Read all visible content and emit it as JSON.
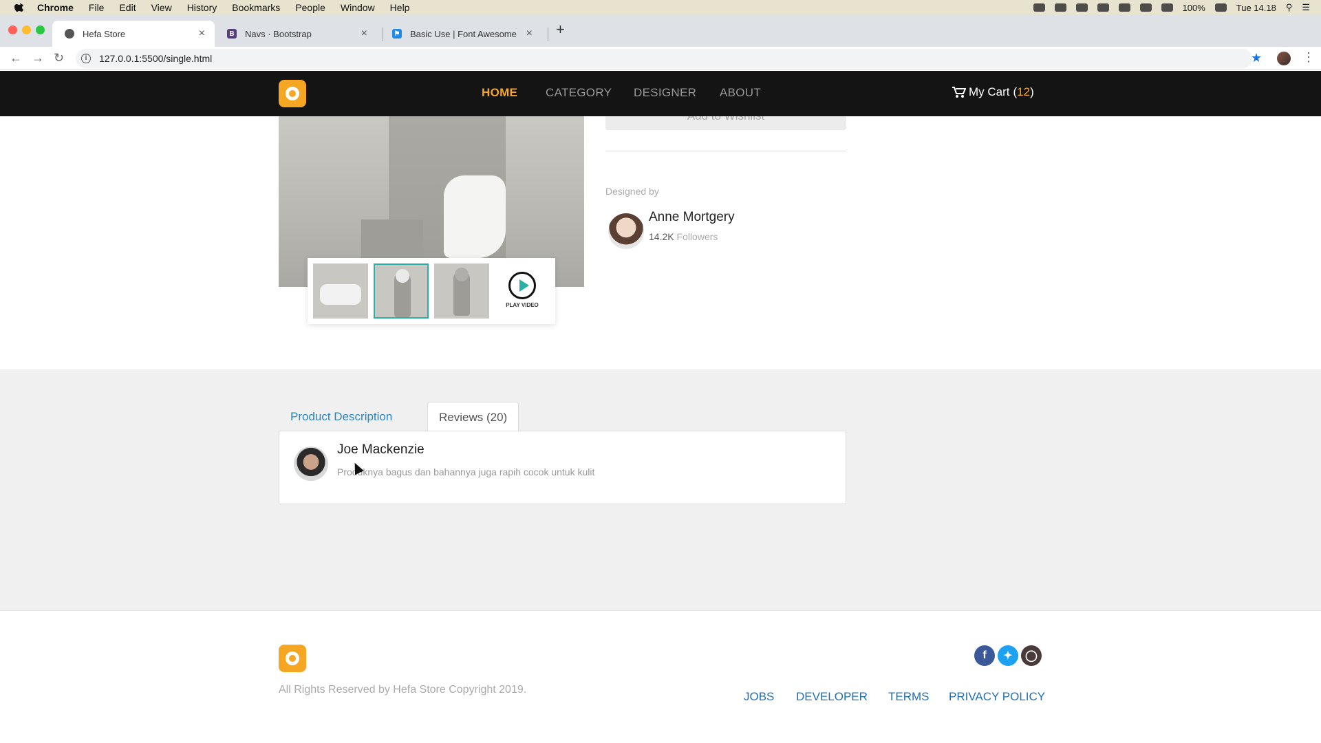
{
  "menubar": {
    "app": "Chrome",
    "items": [
      "File",
      "Edit",
      "View",
      "History",
      "Bookmarks",
      "People",
      "Window",
      "Help"
    ],
    "battery": "100%",
    "clock": "Tue 14.18"
  },
  "browser": {
    "tabs": [
      {
        "title": "Hefa Store"
      },
      {
        "title": "Navs · Bootstrap"
      },
      {
        "title": "Basic Use | Font Awesome"
      }
    ],
    "url": "127.0.0.1:5500/single.html"
  },
  "nav": {
    "items": [
      "HOME",
      "CATEGORY",
      "DESIGNER",
      "ABOUT"
    ],
    "cart_label": "My Cart",
    "cart_count": "12"
  },
  "product": {
    "wishlist_label": "Add to Wishlist",
    "play_label": "PLAY VIDEO",
    "designed_by_label": "Designed by",
    "designer_name": "Anne Mortgery",
    "followers_count": "14.2K",
    "followers_label": "Followers"
  },
  "tabs": {
    "description": "Product Description",
    "reviews": "Reviews (20)"
  },
  "review": {
    "name": "Joe Mackenzie",
    "text": "Produknya bagus dan bahannya juga rapih cocok untuk kulit"
  },
  "footer": {
    "copyright": "All Rights Reserved by Hefa Store Copyright 2019.",
    "links": [
      "JOBS",
      "DEVELOPER",
      "TERMS",
      "PRIVACY POLICY"
    ],
    "social": [
      "facebook-icon",
      "twitter-icon",
      "instagram-icon"
    ]
  },
  "colors": {
    "accent": "#f5a623",
    "link": "#2a86c0",
    "header_bg": "#141414",
    "selection": "#2bb0a6"
  }
}
